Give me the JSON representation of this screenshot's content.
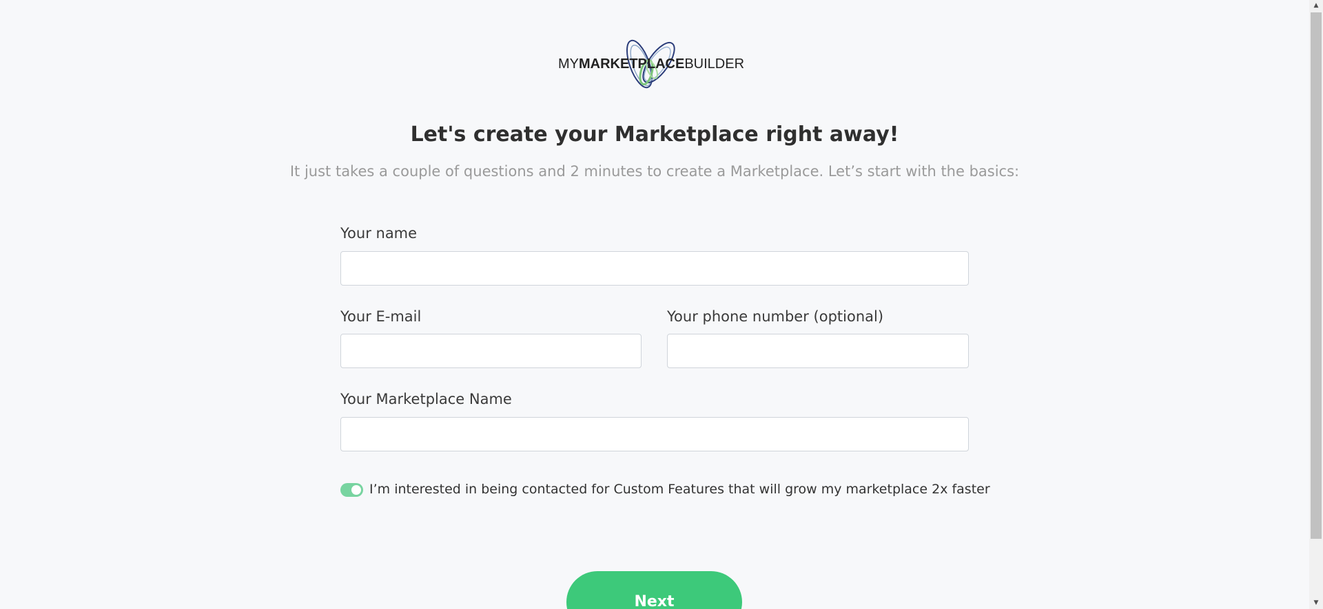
{
  "logo": {
    "part_my": "MY",
    "part_marketplace": "MARKETPLACE",
    "part_builder": "BUILDER",
    "colors": {
      "green": "#7cc47a",
      "navy": "#2b3d7a"
    }
  },
  "heading": {
    "title": "Let's create your Marketplace right away!",
    "subtitle": "It just takes a couple of questions and 2 minutes to create a Marketplace. Let’s start with the basics:"
  },
  "form": {
    "name": {
      "label": "Your name",
      "value": "",
      "placeholder": ""
    },
    "email": {
      "label": "Your E-mail",
      "value": "",
      "placeholder": ""
    },
    "phone": {
      "label": "Your phone number (optional)",
      "value": "",
      "placeholder": ""
    },
    "marketplace_name": {
      "label": "Your Marketplace Name",
      "value": "",
      "placeholder": ""
    },
    "contact_toggle": {
      "label": "I’m interested in being contacted for Custom Features that will grow my marketplace 2x faster",
      "checked": true,
      "color": "#78d4a0"
    }
  },
  "actions": {
    "next_label": "Next",
    "next_color": "#3dc97a"
  },
  "scrollbar": {
    "up_icon": "triangle-up-icon",
    "down_icon": "triangle-down-icon"
  }
}
